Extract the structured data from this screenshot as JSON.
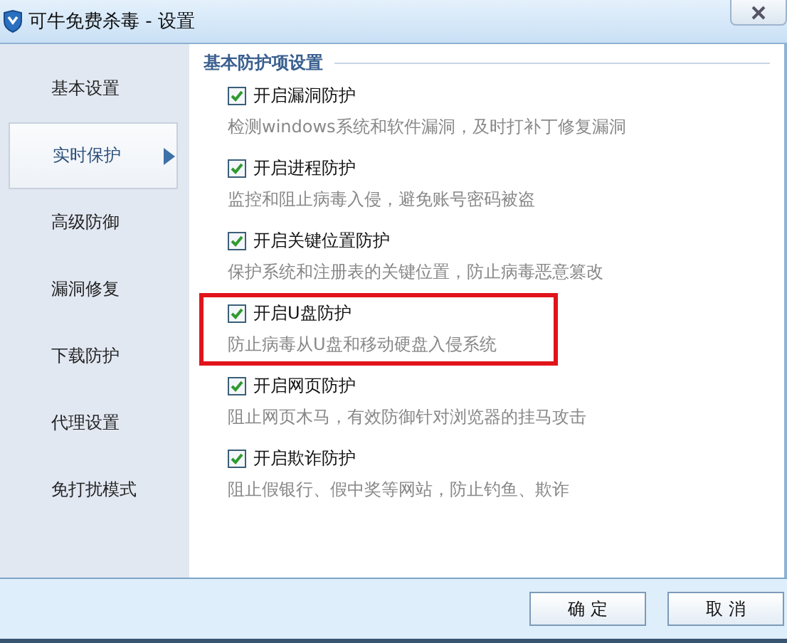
{
  "window": {
    "title": "可牛免费杀毒 - 设置"
  },
  "sidebar": {
    "items": [
      {
        "label": "基本设置",
        "selected": false
      },
      {
        "label": "实时保护",
        "selected": true
      },
      {
        "label": "高级防御",
        "selected": false
      },
      {
        "label": "漏洞修复",
        "selected": false
      },
      {
        "label": "下载防护",
        "selected": false
      },
      {
        "label": "代理设置",
        "selected": false
      },
      {
        "label": "免打扰模式",
        "selected": false
      }
    ]
  },
  "section": {
    "title": "基本防护项设置",
    "options": [
      {
        "label": "开启漏洞防护",
        "description": "检测windows系统和软件漏洞，及时打补丁修复漏洞",
        "checked": true,
        "highlighted": false
      },
      {
        "label": "开启进程防护",
        "description": "监控和阻止病毒入侵，避免账号密码被盗",
        "checked": true,
        "highlighted": false
      },
      {
        "label": "开启关键位置防护",
        "description": "保护系统和注册表的关键位置，防止病毒恶意篡改",
        "checked": true,
        "highlighted": false
      },
      {
        "label": "开启U盘防护",
        "description": "防止病毒从U盘和移动硬盘入侵系统",
        "checked": true,
        "highlighted": true
      },
      {
        "label": "开启网页防护",
        "description": "阻止网页木马，有效防御针对浏览器的挂马攻击",
        "checked": true,
        "highlighted": false
      },
      {
        "label": "开启欺诈防护",
        "description": "阻止假银行、假中奖等网站，防止钓鱼、欺诈",
        "checked": true,
        "highlighted": false
      }
    ]
  },
  "buttons": [
    "确 定",
    "取 消"
  ]
}
